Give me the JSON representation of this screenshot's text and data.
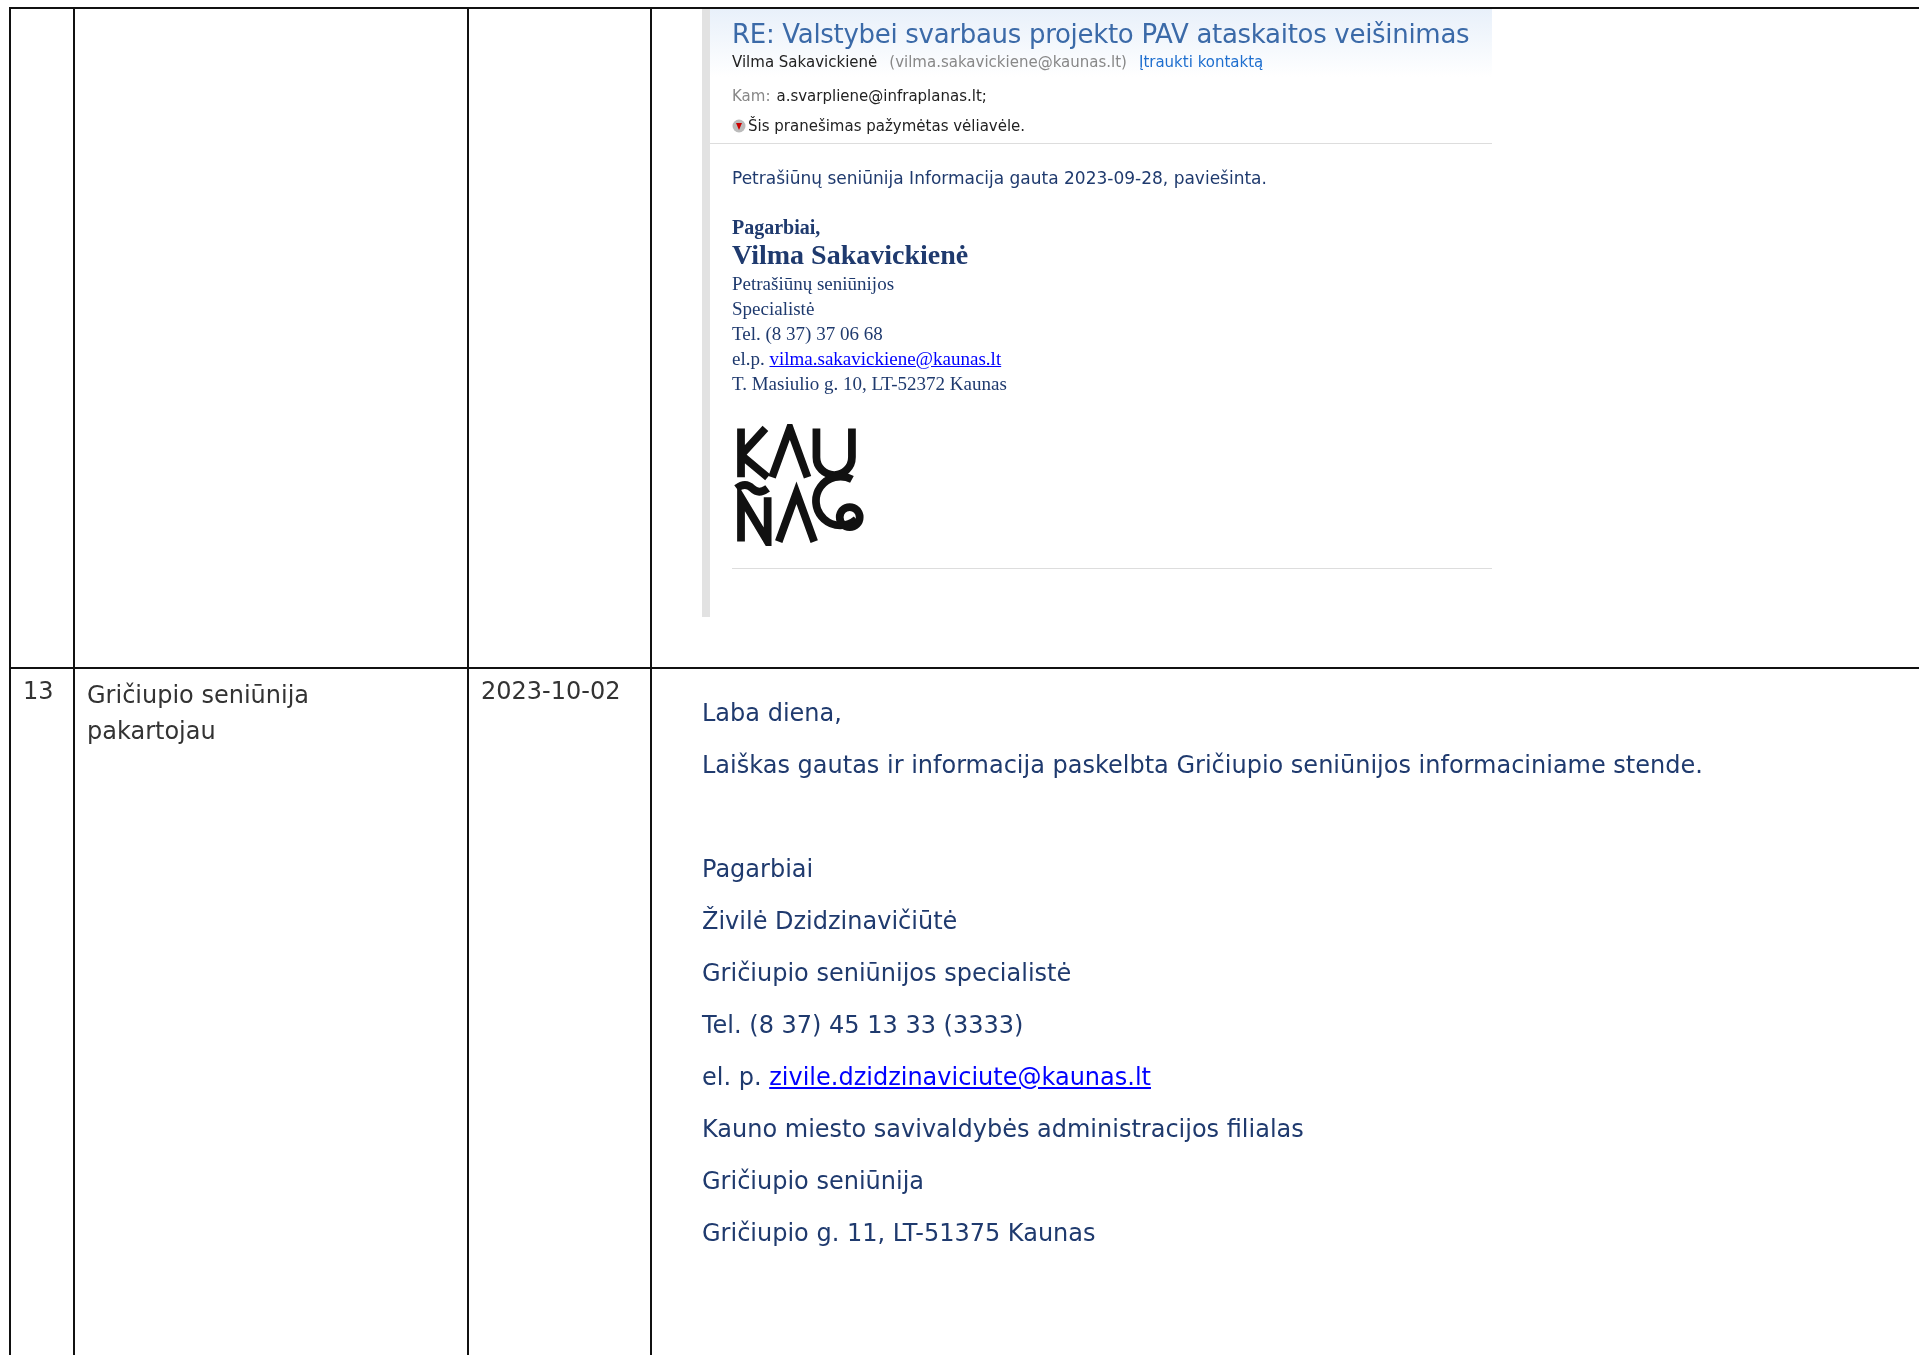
{
  "rows": [
    {
      "number": "",
      "name_lines": [],
      "date": "",
      "email": {
        "subject": "RE:  Valstybei svarbaus projekto PAV ataskaitos veišinimas",
        "sender": "Vilma Sakavickienė",
        "sender_address": "(vilma.sakavickiene@kaunas.lt)",
        "add_contact": "Įtraukti kontaktą",
        "to_label": "Kam:",
        "to": "a.svarpliene@infraplanas.lt;",
        "flag_note": "Šis pranešimas pažymėtas vėliavėle.",
        "body": "Petrašiūnų seniūnija Informacija gauta 2023-09-28, paviešinta.",
        "greeting": "Pagarbiai,",
        "signature_name": "Vilma Sakavickienė",
        "signature_lines": [
          "Petrašiūnų seniūnijos",
          "Specialistė",
          "Tel. (8 37) 37 06 68"
        ],
        "email_prefix": "el.p.",
        "email_link": "vilma.sakavickiene@kaunas.lt",
        "address": "T. Masiulio g. 10, LT-52372 Kaunas"
      }
    },
    {
      "number": "13",
      "name_lines": [
        "Gričiupio seniūnija",
        "pakartojau"
      ],
      "date": "2023-10-02",
      "reply": [
        {
          "kind": "text",
          "text": "Laba diena,"
        },
        {
          "kind": "text",
          "text": "Laiškas gautas ir informacija paskelbta Gričiupio seniūnijos informaciniame stende."
        },
        {
          "kind": "gap"
        },
        {
          "kind": "text",
          "text": "Pagarbiai"
        },
        {
          "kind": "text",
          "text": "Živilė Dzidzinavičiūtė"
        },
        {
          "kind": "text",
          "text": "Gričiupio seniūnijos specialistė"
        },
        {
          "kind": "text",
          "text": "Tel. (8 37) 45 13 33 (3333)"
        },
        {
          "kind": "link",
          "prefix": "el. p.",
          "link": "zivile.dzidzinaviciute@kaunas.lt"
        },
        {
          "kind": "text",
          "text": "Kauno miesto savivaldybės administracijos filialas"
        },
        {
          "kind": "text",
          "text": "Gričiupio seniūnija"
        },
        {
          "kind": "text",
          "text": "Gričiupio g. 11, LT-51375 Kaunas"
        }
      ]
    }
  ]
}
